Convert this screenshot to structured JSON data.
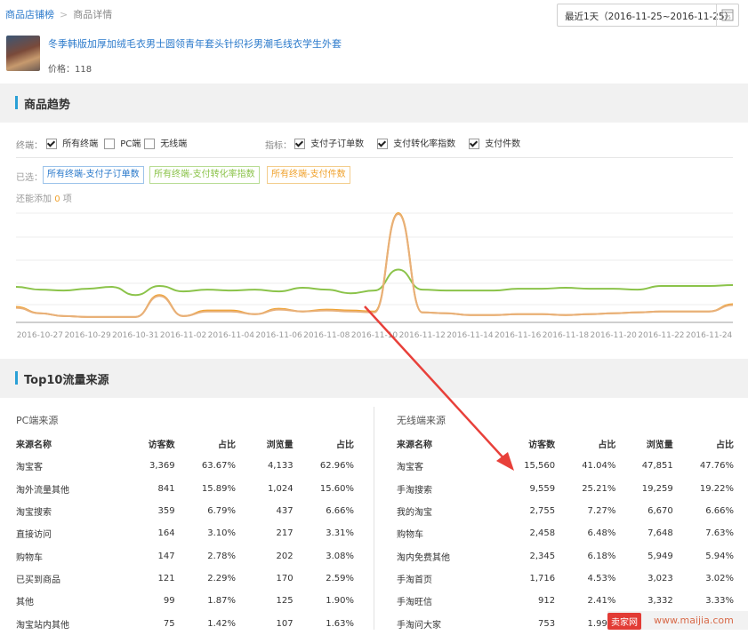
{
  "breadcrumb": {
    "parent": "商品店铺榜",
    "current": "商品详情"
  },
  "date_range": {
    "label": "最近1天（2016-11-25~2016-11-25）",
    "calendar_day": "15"
  },
  "product": {
    "title": "冬季韩版加厚加绒毛衣男士圆领青年套头针织衫男潮毛线衣学生外套",
    "price_label": "价格：118"
  },
  "trend": {
    "title": "商品趋势",
    "terminal_label": "终端：",
    "terminals": [
      {
        "label": "所有终端",
        "checked": true
      },
      {
        "label": "PC端",
        "checked": false
      },
      {
        "label": "无线端",
        "checked": false
      }
    ],
    "metric_label": "指标：",
    "metrics": [
      {
        "label": "支付子订单数",
        "checked": true
      },
      {
        "label": "支付转化率指数",
        "checked": true
      },
      {
        "label": "支付件数",
        "checked": true
      }
    ],
    "selected_label": "已选：",
    "selected_tags": [
      "所有终端-支付子订单数",
      "所有终端-支付转化率指数",
      "所有终端-支付件数"
    ],
    "add_more_prefix": "还能添加",
    "add_more_count": "0",
    "add_more_suffix": "项"
  },
  "chart_data": {
    "type": "line",
    "x": [
      "2016-10-26",
      "2016-10-27",
      "2016-10-28",
      "2016-10-29",
      "2016-10-30",
      "2016-10-31",
      "2016-11-01",
      "2016-11-02",
      "2016-11-03",
      "2016-11-04",
      "2016-11-05",
      "2016-11-06",
      "2016-11-07",
      "2016-11-08",
      "2016-11-09",
      "2016-11-10",
      "2016-11-11",
      "2016-11-12",
      "2016-11-13",
      "2016-11-14",
      "2016-11-15",
      "2016-11-16",
      "2016-11-17",
      "2016-11-18",
      "2016-11-19",
      "2016-11-20",
      "2016-11-21",
      "2016-11-22",
      "2016-11-23",
      "2016-11-24",
      "2016-11-25"
    ],
    "xticks": [
      "2016-10-27",
      "2016-10-29",
      "2016-10-31",
      "2016-11-02",
      "2016-11-04",
      "2016-11-06",
      "2016-11-08",
      "2016-11-10",
      "2016-11-12",
      "2016-11-14",
      "2016-11-16",
      "2016-11-18",
      "2016-11-20",
      "2016-11-22",
      "2016-11-24"
    ],
    "ylim": [
      0,
      120
    ],
    "grid": true,
    "series": [
      {
        "name": "所有终端-支付转化率指数",
        "color": "#8bc34a",
        "values": [
          39,
          36,
          35,
          37,
          39,
          30,
          40,
          34,
          36,
          35,
          36,
          34,
          38,
          36,
          32,
          35,
          58,
          36,
          35,
          35,
          35,
          37,
          37,
          38,
          37,
          37,
          36,
          40,
          40,
          40,
          41
        ]
      },
      {
        "name": "所有终端-支付件数",
        "color": "#f0a22d",
        "values": [
          17,
          10,
          7,
          6,
          6,
          6,
          30,
          7,
          13,
          13,
          9,
          15,
          12,
          14,
          13,
          12,
          120,
          11,
          10,
          8,
          8,
          9,
          9,
          8,
          9,
          10,
          11,
          12,
          12,
          12,
          20
        ]
      },
      {
        "name": "所有终端-支付子订单数",
        "color": "#e8b07a",
        "values": [
          16,
          10,
          7,
          6,
          6,
          6,
          29,
          7,
          12,
          12,
          9,
          14,
          12,
          13,
          12,
          11,
          119,
          11,
          10,
          8,
          8,
          9,
          9,
          8,
          9,
          10,
          11,
          12,
          12,
          12,
          19
        ]
      }
    ]
  },
  "top10": {
    "title": "Top10流量来源",
    "pc": {
      "title": "PC端来源",
      "headers": [
        "来源名称",
        "访客数",
        "占比",
        "浏览量",
        "占比"
      ],
      "rows": [
        [
          "淘宝客",
          "3,369",
          "63.67%",
          "4,133",
          "62.96%"
        ],
        [
          "淘外流量其他",
          "841",
          "15.89%",
          "1,024",
          "15.60%"
        ],
        [
          "淘宝搜索",
          "359",
          "6.79%",
          "437",
          "6.66%"
        ],
        [
          "直接访问",
          "164",
          "3.10%",
          "217",
          "3.31%"
        ],
        [
          "购物车",
          "147",
          "2.78%",
          "202",
          "3.08%"
        ],
        [
          "已买到商品",
          "121",
          "2.29%",
          "170",
          "2.59%"
        ],
        [
          "其他",
          "99",
          "1.87%",
          "125",
          "1.90%"
        ],
        [
          "淘宝站内其他",
          "75",
          "1.42%",
          "107",
          "1.63%"
        ]
      ]
    },
    "mobile": {
      "title": "无线端来源",
      "headers": [
        "来源名称",
        "访客数",
        "占比",
        "浏览量",
        "占比"
      ],
      "rows": [
        [
          "淘宝客",
          "15,560",
          "41.04%",
          "47,851",
          "47.76%"
        ],
        [
          "手淘搜索",
          "9,559",
          "25.21%",
          "19,259",
          "19.22%"
        ],
        [
          "我的淘宝",
          "2,755",
          "7.27%",
          "6,670",
          "6.66%"
        ],
        [
          "购物车",
          "2,458",
          "6.48%",
          "7,648",
          "7.63%"
        ],
        [
          "淘内免费其他",
          "2,345",
          "6.18%",
          "5,949",
          "5.94%"
        ],
        [
          "手淘首页",
          "1,716",
          "4.53%",
          "3,023",
          "3.02%"
        ],
        [
          "手淘旺信",
          "912",
          "2.41%",
          "3,332",
          "3.33%"
        ],
        [
          "手淘问大家",
          "753",
          "1.99%",
          "",
          ""
        ]
      ]
    }
  },
  "watermark": {
    "badge": "卖家网",
    "site": "www.maijia.com"
  },
  "annotation": {
    "arrow_color": "#e8403a"
  }
}
